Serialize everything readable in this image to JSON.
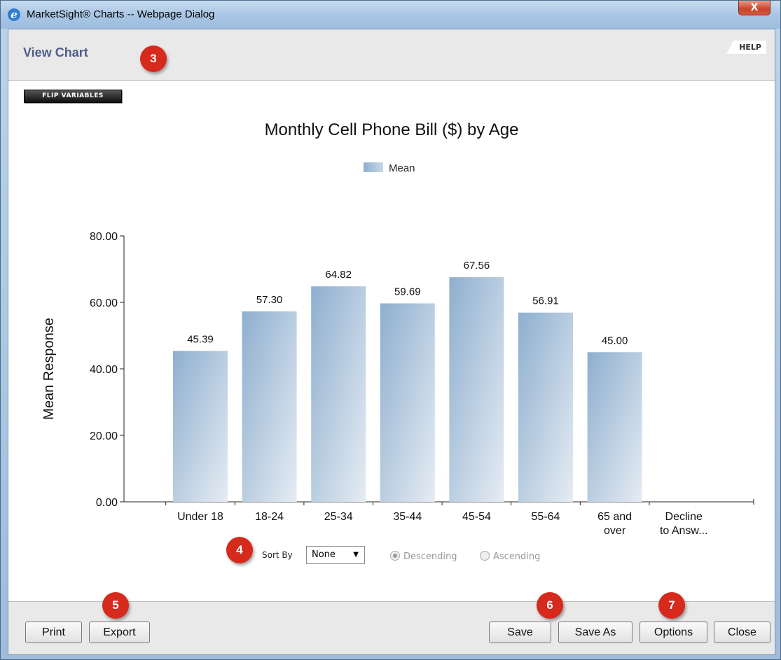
{
  "window": {
    "title": "MarketSight® Charts -- Webpage Dialog",
    "close_glyph": "X",
    "app_icon_glyph": "e"
  },
  "header": {
    "title": "View Chart",
    "help_label": "HELP"
  },
  "toolbar": {
    "flip_label": "FLIP VARIABLES"
  },
  "callouts": [
    "3",
    "4",
    "5",
    "6",
    "7"
  ],
  "chart_data": {
    "type": "bar",
    "title": "Monthly Cell Phone Bill ($) by Age",
    "ylabel": "Mean Response",
    "xlabel": "",
    "ylim": [
      0,
      80
    ],
    "yticks": [
      "0.00",
      "20.00",
      "40.00",
      "60.00",
      "80.00"
    ],
    "legend": "top-center",
    "categories": [
      [
        "Under 18"
      ],
      [
        "18-24"
      ],
      [
        "25-34"
      ],
      [
        "35-44"
      ],
      [
        "45-54"
      ],
      [
        "55-64"
      ],
      [
        "65 and",
        "over"
      ],
      [
        "Decline",
        "to Answ..."
      ]
    ],
    "series": [
      {
        "name": "Mean",
        "values": [
          45.39,
          57.3,
          64.82,
          59.69,
          67.56,
          56.91,
          45.0,
          null
        ],
        "labels": [
          "45.39",
          "57.30",
          "64.82",
          "59.69",
          "67.56",
          "56.91",
          "45.00",
          ""
        ]
      }
    ],
    "colors": {
      "bar_start": "#8eafcf",
      "bar_end": "#e6ecf3"
    }
  },
  "sort": {
    "label": "Sort By",
    "selected": "None",
    "options": [
      {
        "label": "Descending",
        "checked": true
      },
      {
        "label": "Ascending",
        "checked": false
      }
    ]
  },
  "footer": {
    "print": "Print",
    "export": "Export",
    "save": "Save",
    "save_as": "Save As",
    "options": "Options",
    "close": "Close"
  }
}
